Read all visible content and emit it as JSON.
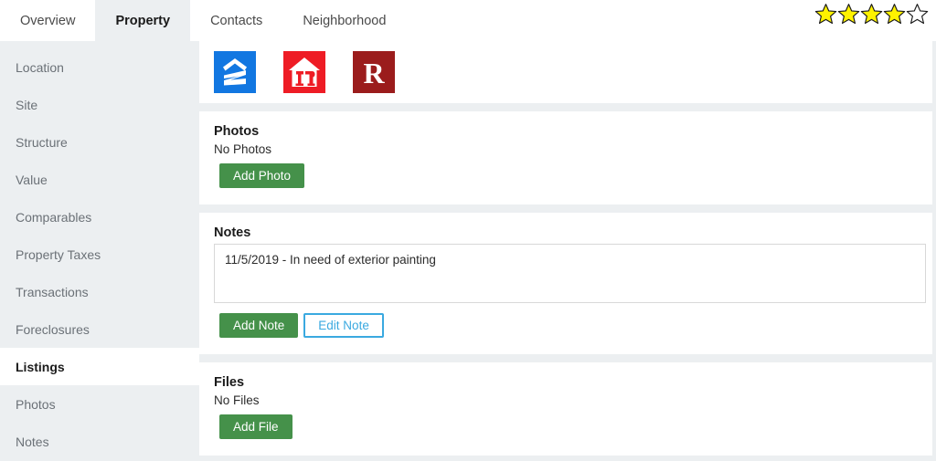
{
  "topbar": {
    "tabs": [
      {
        "label": "Overview",
        "active": false
      },
      {
        "label": "Property",
        "active": true
      },
      {
        "label": "Contacts",
        "active": false
      },
      {
        "label": "Neighborhood",
        "active": false
      }
    ],
    "rating": {
      "filled": 4,
      "total": 5,
      "fill_color": "#FFF200",
      "outline_color": "#1a1a1a"
    }
  },
  "sidebar": {
    "items": [
      {
        "label": "Location",
        "active": false
      },
      {
        "label": "Site",
        "active": false
      },
      {
        "label": "Structure",
        "active": false
      },
      {
        "label": "Value",
        "active": false
      },
      {
        "label": "Comparables",
        "active": false
      },
      {
        "label": "Property Taxes",
        "active": false
      },
      {
        "label": "Transactions",
        "active": false
      },
      {
        "label": "Foreclosures",
        "active": false
      },
      {
        "label": "Listings",
        "active": true
      },
      {
        "label": "Photos",
        "active": false
      },
      {
        "label": "Notes",
        "active": false
      }
    ]
  },
  "main": {
    "listing_sites": [
      {
        "name": "zillow-logo",
        "bg": "#1277E1",
        "mark": "#ffffff"
      },
      {
        "name": "realtor-house-logo",
        "bg": "#EE1C25",
        "mark": "#ffffff"
      },
      {
        "name": "redfin-r-logo",
        "bg": "#9B1C1C",
        "mark": "#ffffff",
        "letter": "R"
      }
    ],
    "photos": {
      "title": "Photos",
      "empty_text": "No Photos",
      "add_label": "Add Photo"
    },
    "notes": {
      "title": "Notes",
      "note_text": "11/5/2019 - In need of exterior painting",
      "add_label": "Add Note",
      "edit_label": "Edit Note"
    },
    "files": {
      "title": "Files",
      "empty_text": "No Files",
      "add_label": "Add File"
    }
  },
  "colors": {
    "page_bg": "#eceff1",
    "card_bg": "#ffffff",
    "green_button": "#45914a",
    "blue_outline": "#3aa9e0",
    "star_yellow": "#FFF200"
  }
}
